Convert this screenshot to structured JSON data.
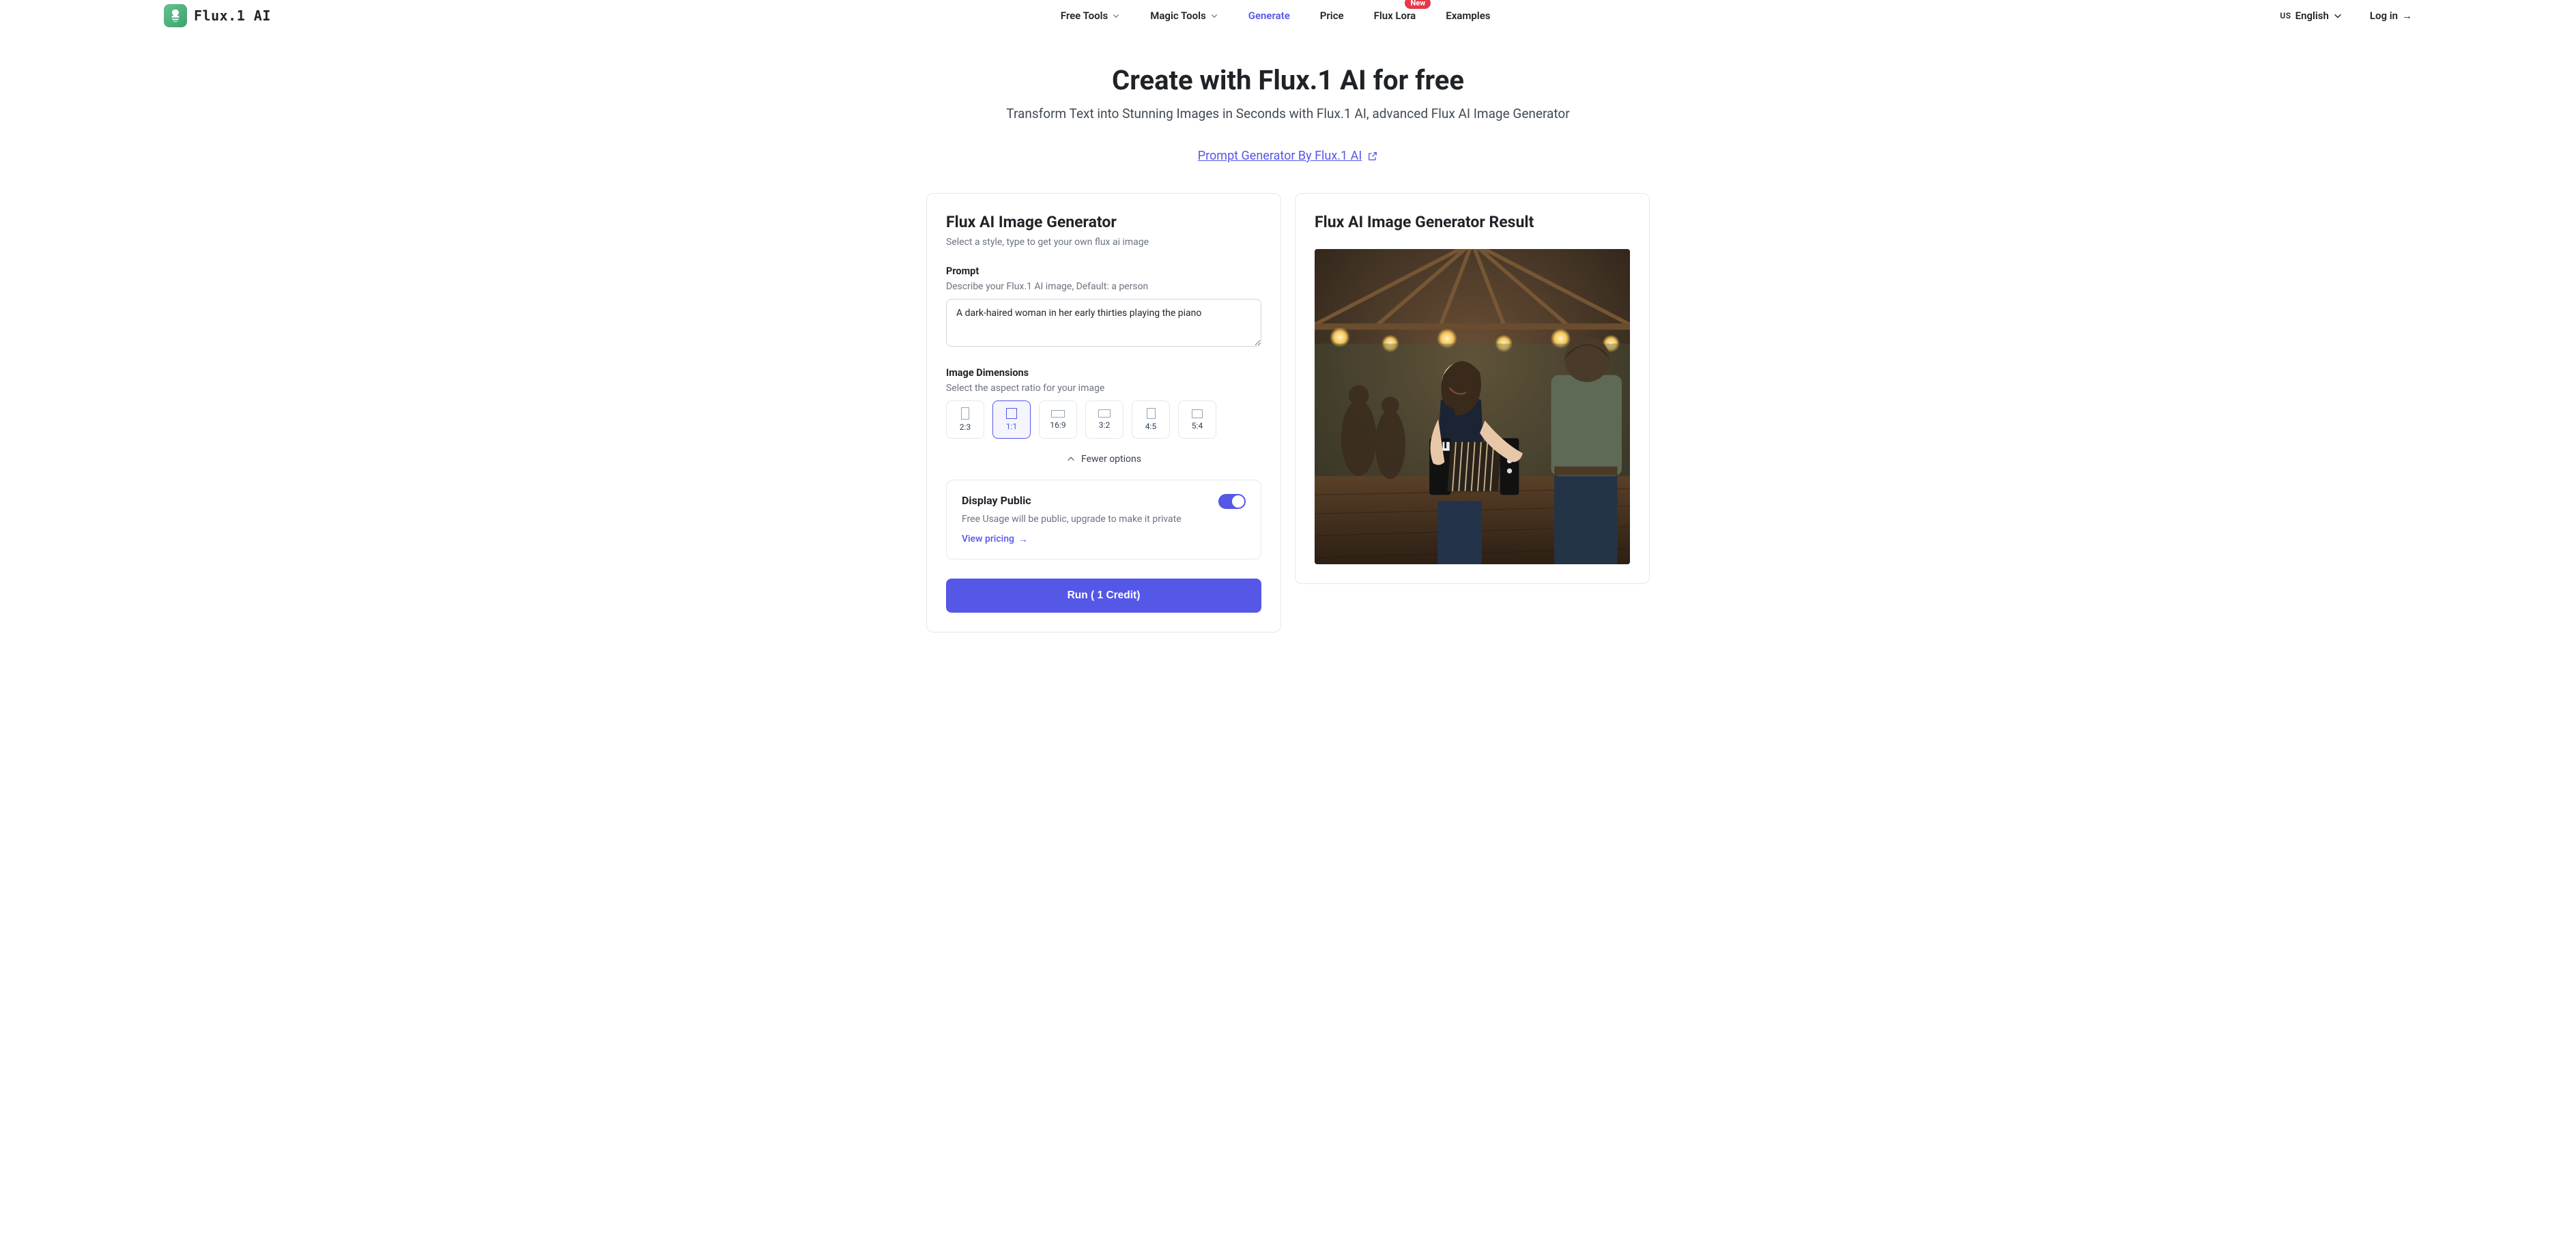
{
  "brand": {
    "name": "Flux.1 AI"
  },
  "nav": {
    "free_tools": "Free Tools",
    "magic_tools": "Magic Tools",
    "generate": "Generate",
    "price": "Price",
    "flux_lora": "Flux Lora",
    "flux_lora_badge": "New",
    "examples": "Examples"
  },
  "right": {
    "lang_prefix": "US",
    "lang": "English",
    "login": "Log in"
  },
  "hero": {
    "title": "Create with Flux.1 AI for free",
    "subtitle": "Transform Text into Stunning Images in Seconds with Flux.1 AI, advanced Flux AI Image Generator",
    "prompt_gen": "Prompt Generator By Flux.1 AI"
  },
  "gen": {
    "title": "Flux AI Image Generator",
    "hint": "Select a style, type to get your own flux ai image",
    "prompt_label": "Prompt",
    "prompt_sub": "Describe your Flux.1 AI image, Default: a person",
    "prompt_value": "A dark-haired woman in her early thirties playing the piano",
    "dim_label": "Image Dimensions",
    "dim_sub": "Select the aspect ratio for your image",
    "ratios": [
      "2:3",
      "1:1",
      "16:9",
      "3:2",
      "4:5",
      "5:4"
    ],
    "selected_ratio": "1:1",
    "fewer": "Fewer options",
    "public_title": "Display Public",
    "public_desc": "Free Usage will be public, upgrade to make it private",
    "public_link": "View pricing",
    "run": "Run   ( 1 Credit)"
  },
  "result": {
    "title": "Flux AI Image Generator Result"
  }
}
